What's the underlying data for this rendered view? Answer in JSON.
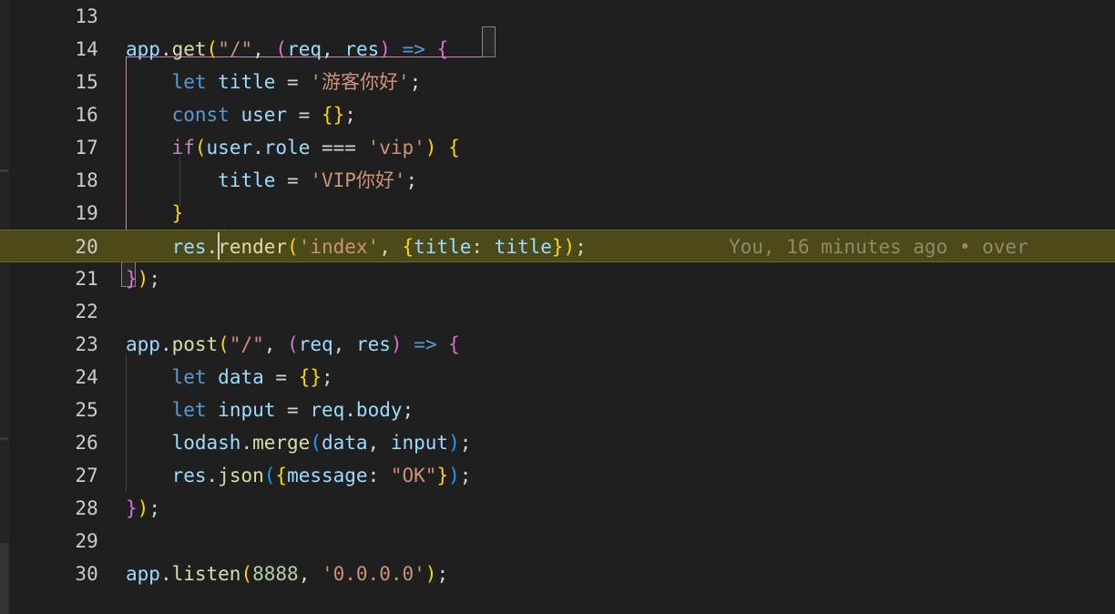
{
  "editor": {
    "theme": "dark-modern",
    "background_color": "#1f1f1f",
    "active_line_color": "#4b4a18",
    "line_height_px": 36,
    "font_size_px": 21
  },
  "gutter": {
    "breakpoint": {
      "line": 20,
      "icon": "breakpoint-arrow-icon",
      "outline_color": "#ffd700",
      "dot_color": "#e51400"
    }
  },
  "cursor": {
    "line": 20,
    "column": 13,
    "color": "#d0d0c8"
  },
  "blame": {
    "line": 20,
    "text": "You, 16 minutes ago • over",
    "color": "#8d8b6e"
  },
  "lines": [
    {
      "number": "13",
      "tokens": []
    },
    {
      "number": "14",
      "tokens": [
        {
          "text": "app",
          "cls": "t-var"
        },
        {
          "text": ".",
          "cls": "t-plain"
        },
        {
          "text": "get",
          "cls": "t-fn"
        },
        {
          "text": "(",
          "cls": "t-b1"
        },
        {
          "text": "\"/\"",
          "cls": "t-str"
        },
        {
          "text": ", ",
          "cls": "t-plain"
        },
        {
          "text": "(",
          "cls": "t-b2"
        },
        {
          "text": "req",
          "cls": "t-var"
        },
        {
          "text": ", ",
          "cls": "t-plain"
        },
        {
          "text": "res",
          "cls": "t-var"
        },
        {
          "text": ")",
          "cls": "t-b2"
        },
        {
          "text": " ",
          "cls": "t-plain"
        },
        {
          "text": "=>",
          "cls": "t-kw"
        },
        {
          "text": " ",
          "cls": "t-plain"
        },
        {
          "text": "{",
          "cls": "t-b2"
        }
      ]
    },
    {
      "number": "15",
      "tokens": [
        {
          "text": "    ",
          "cls": "t-plain"
        },
        {
          "text": "let",
          "cls": "t-kw"
        },
        {
          "text": " ",
          "cls": "t-plain"
        },
        {
          "text": "title",
          "cls": "t-var"
        },
        {
          "text": " = ",
          "cls": "t-plain"
        },
        {
          "text": "'游客你好'",
          "cls": "t-str"
        },
        {
          "text": ";",
          "cls": "t-plain"
        }
      ]
    },
    {
      "number": "16",
      "tokens": [
        {
          "text": "    ",
          "cls": "t-plain"
        },
        {
          "text": "const",
          "cls": "t-kw"
        },
        {
          "text": " ",
          "cls": "t-plain"
        },
        {
          "text": "user",
          "cls": "t-var"
        },
        {
          "text": " = ",
          "cls": "t-plain"
        },
        {
          "text": "{",
          "cls": "t-b1"
        },
        {
          "text": "}",
          "cls": "t-b1"
        },
        {
          "text": ";",
          "cls": "t-plain"
        }
      ]
    },
    {
      "number": "17",
      "tokens": [
        {
          "text": "    ",
          "cls": "t-plain"
        },
        {
          "text": "if",
          "cls": "t-ctrl"
        },
        {
          "text": "(",
          "cls": "t-b1"
        },
        {
          "text": "user",
          "cls": "t-var"
        },
        {
          "text": ".",
          "cls": "t-plain"
        },
        {
          "text": "role",
          "cls": "t-var"
        },
        {
          "text": " === ",
          "cls": "t-plain"
        },
        {
          "text": "'vip'",
          "cls": "t-str"
        },
        {
          "text": ")",
          "cls": "t-b1"
        },
        {
          "text": " ",
          "cls": "t-plain"
        },
        {
          "text": "{",
          "cls": "t-b1"
        }
      ]
    },
    {
      "number": "18",
      "tokens": [
        {
          "text": "        ",
          "cls": "t-plain"
        },
        {
          "text": "title",
          "cls": "t-var"
        },
        {
          "text": " = ",
          "cls": "t-plain"
        },
        {
          "text": "'VIP你好'",
          "cls": "t-str"
        },
        {
          "text": ";",
          "cls": "t-plain"
        }
      ]
    },
    {
      "number": "19",
      "tokens": [
        {
          "text": "    ",
          "cls": "t-plain"
        },
        {
          "text": "}",
          "cls": "t-b1"
        }
      ]
    },
    {
      "number": "20",
      "active": true,
      "tokens": [
        {
          "text": "    ",
          "cls": "t-plain"
        },
        {
          "text": "res",
          "cls": "t-var"
        },
        {
          "text": ".",
          "cls": "t-plain"
        },
        {
          "text": "render",
          "cls": "t-fn"
        },
        {
          "text": "(",
          "cls": "t-b1"
        },
        {
          "text": "'index'",
          "cls": "t-str"
        },
        {
          "text": ", ",
          "cls": "t-plain"
        },
        {
          "text": "{",
          "cls": "t-b1"
        },
        {
          "text": "title",
          "cls": "t-var"
        },
        {
          "text": ": ",
          "cls": "t-plain"
        },
        {
          "text": "title",
          "cls": "t-var"
        },
        {
          "text": "}",
          "cls": "t-b1"
        },
        {
          "text": ")",
          "cls": "t-b1"
        },
        {
          "text": ";",
          "cls": "t-plain"
        }
      ]
    },
    {
      "number": "21",
      "tokens": [
        {
          "text": "}",
          "cls": "t-b2"
        },
        {
          "text": ")",
          "cls": "t-b1"
        },
        {
          "text": ";",
          "cls": "t-plain"
        }
      ]
    },
    {
      "number": "22",
      "tokens": []
    },
    {
      "number": "23",
      "tokens": [
        {
          "text": "app",
          "cls": "t-var"
        },
        {
          "text": ".",
          "cls": "t-plain"
        },
        {
          "text": "post",
          "cls": "t-fn"
        },
        {
          "text": "(",
          "cls": "t-b1"
        },
        {
          "text": "\"/\"",
          "cls": "t-str"
        },
        {
          "text": ", ",
          "cls": "t-plain"
        },
        {
          "text": "(",
          "cls": "t-b2"
        },
        {
          "text": "req",
          "cls": "t-var"
        },
        {
          "text": ", ",
          "cls": "t-plain"
        },
        {
          "text": "res",
          "cls": "t-var"
        },
        {
          "text": ")",
          "cls": "t-b2"
        },
        {
          "text": " ",
          "cls": "t-plain"
        },
        {
          "text": "=>",
          "cls": "t-kw"
        },
        {
          "text": " ",
          "cls": "t-plain"
        },
        {
          "text": "{",
          "cls": "t-b2"
        }
      ]
    },
    {
      "number": "24",
      "tokens": [
        {
          "text": "    ",
          "cls": "t-plain"
        },
        {
          "text": "let",
          "cls": "t-kw"
        },
        {
          "text": " ",
          "cls": "t-plain"
        },
        {
          "text": "data",
          "cls": "t-var"
        },
        {
          "text": " = ",
          "cls": "t-plain"
        },
        {
          "text": "{",
          "cls": "t-b1"
        },
        {
          "text": "}",
          "cls": "t-b1"
        },
        {
          "text": ";",
          "cls": "t-plain"
        }
      ]
    },
    {
      "number": "25",
      "tokens": [
        {
          "text": "    ",
          "cls": "t-plain"
        },
        {
          "text": "let",
          "cls": "t-kw"
        },
        {
          "text": " ",
          "cls": "t-plain"
        },
        {
          "text": "input",
          "cls": "t-var"
        },
        {
          "text": " = ",
          "cls": "t-plain"
        },
        {
          "text": "req",
          "cls": "t-var"
        },
        {
          "text": ".",
          "cls": "t-plain"
        },
        {
          "text": "body",
          "cls": "t-var"
        },
        {
          "text": ";",
          "cls": "t-plain"
        }
      ]
    },
    {
      "number": "26",
      "tokens": [
        {
          "text": "    ",
          "cls": "t-plain"
        },
        {
          "text": "lodash",
          "cls": "t-var"
        },
        {
          "text": ".",
          "cls": "t-plain"
        },
        {
          "text": "merge",
          "cls": "t-fn"
        },
        {
          "text": "(",
          "cls": "t-b3"
        },
        {
          "text": "data",
          "cls": "t-var"
        },
        {
          "text": ", ",
          "cls": "t-plain"
        },
        {
          "text": "input",
          "cls": "t-var"
        },
        {
          "text": ")",
          "cls": "t-b3"
        },
        {
          "text": ";",
          "cls": "t-plain"
        }
      ]
    },
    {
      "number": "27",
      "tokens": [
        {
          "text": "    ",
          "cls": "t-plain"
        },
        {
          "text": "res",
          "cls": "t-var"
        },
        {
          "text": ".",
          "cls": "t-plain"
        },
        {
          "text": "json",
          "cls": "t-fn"
        },
        {
          "text": "(",
          "cls": "t-b3"
        },
        {
          "text": "{",
          "cls": "t-b1"
        },
        {
          "text": "message",
          "cls": "t-var"
        },
        {
          "text": ": ",
          "cls": "t-plain"
        },
        {
          "text": "\"OK\"",
          "cls": "t-str"
        },
        {
          "text": "}",
          "cls": "t-b1"
        },
        {
          "text": ")",
          "cls": "t-b3"
        },
        {
          "text": ";",
          "cls": "t-plain"
        }
      ]
    },
    {
      "number": "28",
      "tokens": [
        {
          "text": "}",
          "cls": "t-b2"
        },
        {
          "text": ")",
          "cls": "t-b1"
        },
        {
          "text": ";",
          "cls": "t-plain"
        }
      ]
    },
    {
      "number": "29",
      "tokens": []
    },
    {
      "number": "30",
      "tokens": [
        {
          "text": "app",
          "cls": "t-var"
        },
        {
          "text": ".",
          "cls": "t-plain"
        },
        {
          "text": "listen",
          "cls": "t-fn"
        },
        {
          "text": "(",
          "cls": "t-b1"
        },
        {
          "text": "8888",
          "cls": "t-num"
        },
        {
          "text": ", ",
          "cls": "t-plain"
        },
        {
          "text": "'0.0.0.0'",
          "cls": "t-str"
        },
        {
          "text": ")",
          "cls": "t-b1"
        },
        {
          "text": ";",
          "cls": "t-plain"
        }
      ]
    }
  ]
}
